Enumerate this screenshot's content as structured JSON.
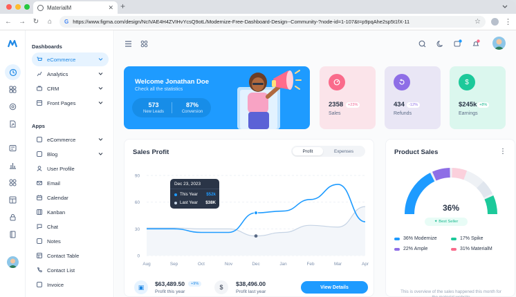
{
  "browser": {
    "tab_title": "MaterialM",
    "url": "https://www.figma.com/design/NcIVAE4H4ZVIHvYcsQ9otL/Modernize-Free-Dashboard-Design--Community-?node-id=1-107&t=p9pqAhe2sp5t1fX-11"
  },
  "nav": {
    "section_dashboards": "Dashboards",
    "dashboards": [
      {
        "label": "eCommerce",
        "active": true
      },
      {
        "label": "Analytics"
      },
      {
        "label": "CRM"
      },
      {
        "label": "Front Pages"
      }
    ],
    "section_apps": "Apps",
    "apps": [
      {
        "label": "eCommerce"
      },
      {
        "label": "Blog"
      },
      {
        "label": "User Profile"
      },
      {
        "label": "Email"
      },
      {
        "label": "Calendar"
      },
      {
        "label": "Kanban"
      },
      {
        "label": "Chat"
      },
      {
        "label": "Notes"
      },
      {
        "label": "Contact Table"
      },
      {
        "label": "Contact List"
      },
      {
        "label": "Invoice"
      }
    ]
  },
  "welcome": {
    "title": "Welcome Jonathan Doe",
    "subtitle": "Check all the statistics",
    "leads_value": "573",
    "leads_label": "New Leads",
    "conversion_value": "87%",
    "conversion_label": "Conversion"
  },
  "kpis": [
    {
      "value": "2358",
      "change": "+23%",
      "label": "Sales",
      "bg": "#fbe4ea",
      "icon_bg": "#fa6b8b",
      "chg_color": "#f06292",
      "chg_bg": "#ffffff"
    },
    {
      "value": "434",
      "change": "-12%",
      "label": "Refunds",
      "bg": "#e9e6f5",
      "icon_bg": "#8e6ee6",
      "chg_color": "#8e6ee6",
      "chg_bg": "#ffffff"
    },
    {
      "value": "$245k",
      "change": "+8%",
      "label": "Earnings",
      "bg": "#dbf7ee",
      "icon_bg": "#1cc99a",
      "chg_color": "#13b78c",
      "chg_bg": "#ffffff"
    }
  ],
  "sales_profit": {
    "title": "Sales Profit",
    "tab_profit": "Profit",
    "tab_expenses": "Expenses",
    "tooltip_date": "Dec 23, 2023",
    "tooltip_this_year_label": "This Year",
    "tooltip_this_year_value": "$52k",
    "tooltip_last_year_label": "Last Year",
    "tooltip_last_year_value": "$38K",
    "profit_value": "$63,489.50",
    "profit_badge": "+9%",
    "profit_label": "Profit this year",
    "last_value": "$38,496.00",
    "last_label": "Profit last year",
    "button": "View Details"
  },
  "chart_data": {
    "type": "line",
    "categories": [
      "Aug",
      "Sep",
      "Oct",
      "Nov",
      "Dec",
      "Jan",
      "Feb",
      "Mar",
      "Apr"
    ],
    "ylim": [
      0,
      90
    ],
    "yticks": [
      0,
      30,
      60,
      90
    ],
    "series": [
      {
        "name": "This Year",
        "color": "#1e9bff",
        "values": [
          30,
          30,
          26,
          26,
          48,
          50,
          63,
          80,
          38
        ]
      },
      {
        "name": "Last Year",
        "color": "#c5d3e4",
        "values": [
          31,
          31,
          30,
          30,
          22,
          26,
          34,
          32,
          55
        ]
      }
    ],
    "highlight_index": 4,
    "grid": true
  },
  "product_sales": {
    "title": "Product Sales",
    "center_pct": "36%",
    "badge": "Best Seller",
    "legend": [
      {
        "label": "36% Modernize",
        "color": "#1e9bff"
      },
      {
        "label": "17% Spike",
        "color": "#1cc99a"
      },
      {
        "label": "22% Ample",
        "color": "#8e6ee6"
      },
      {
        "label": "31% MaterialM",
        "color": "#fa6b8b"
      }
    ],
    "note": "This is overview of the sales happened this month for the material website"
  }
}
